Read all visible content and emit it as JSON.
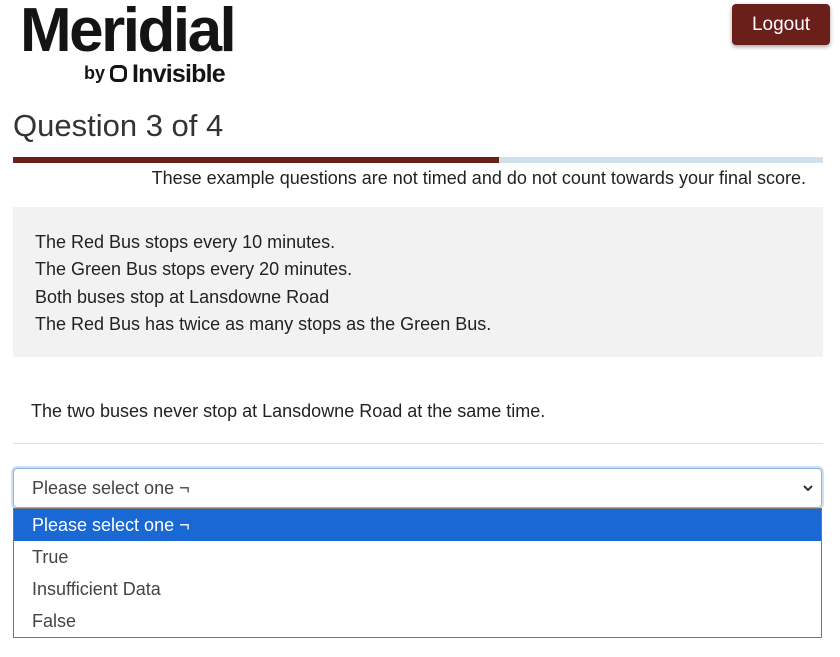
{
  "brand": {
    "name": "Meridial",
    "by": "by",
    "company": "Invisible",
    "accent_color": "#6b1f1b"
  },
  "header": {
    "logout_label": "Logout"
  },
  "question": {
    "title": "Question 3 of 4",
    "progress_fraction": 0.6,
    "notice": "These example questions are not timed and do not count towards your final score.",
    "premises": [
      "The Red Bus stops every 10 minutes.",
      "The Green Bus stops every 20 minutes.",
      "Both buses stop at Lansdowne Road",
      "The Red Bus has twice as many stops as the Green Bus."
    ],
    "statement": "The two buses never stop at Lansdowne Road at the same time."
  },
  "answer_select": {
    "selected_value": "Please select one ¬",
    "icon": "chevron-down-icon",
    "options": [
      "Please select one ¬",
      "True",
      "Insufficient Data",
      "False"
    ],
    "highlight_color": "#1a68d3"
  }
}
